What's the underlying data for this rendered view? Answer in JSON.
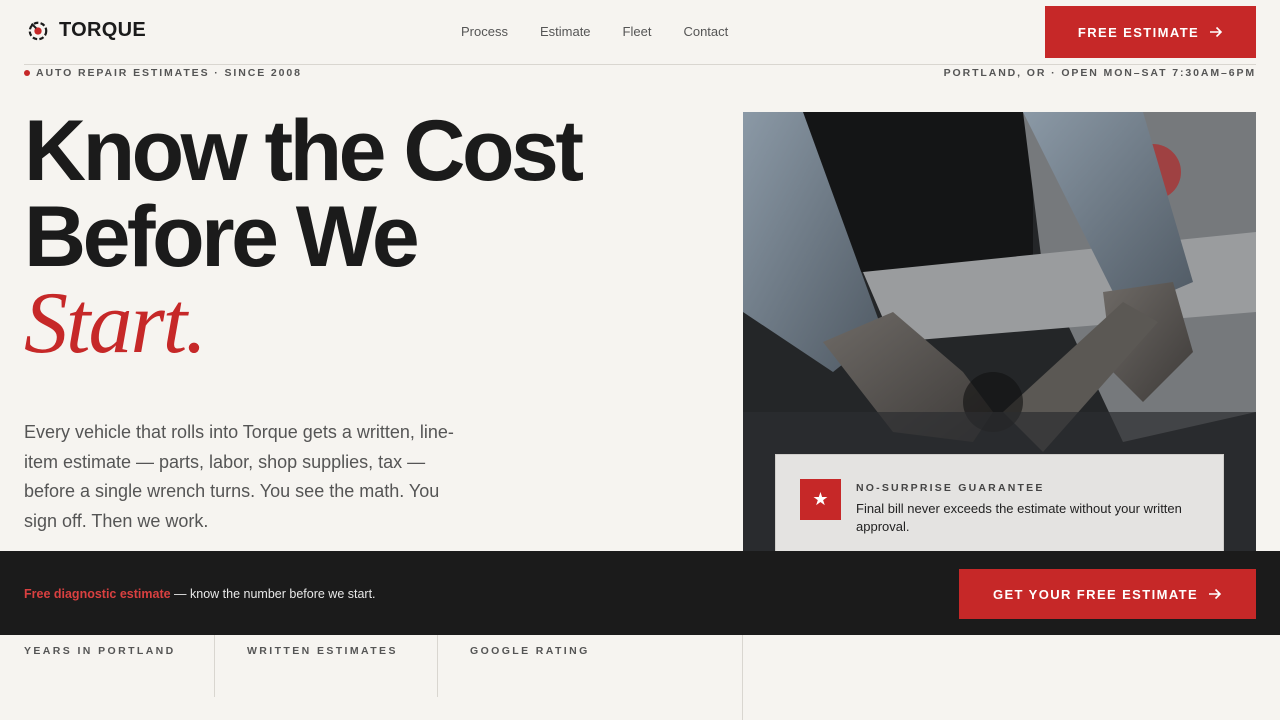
{
  "brand": {
    "name": "TORQUE",
    "icon": "gear-icon"
  },
  "nav": {
    "items": [
      "Process",
      "Estimate",
      "Fleet",
      "Contact"
    ]
  },
  "header_cta": {
    "label": "FREE ESTIMATE",
    "icon": "arrow-right-icon"
  },
  "subbar": {
    "left": "AUTO REPAIR ESTIMATES · SINCE 2008",
    "right": "PORTLAND, OR · OPEN MON–SAT 7:30AM–6PM"
  },
  "hero": {
    "line1": "Know the Cost",
    "line2": "Before We",
    "accent": "Start.",
    "intro": "Every vehicle that rolls into Torque gets a written, line-item estimate — parts, labor, shop supplies, tax — before a single wrench turns. You see the math. You sign off. Then we work."
  },
  "guarantee": {
    "icon": "star-icon",
    "title": "NO-SURPRISE GUARANTEE",
    "text": "Final bill never exceeds the estimate without your written approval."
  },
  "band": {
    "highlight": "Free diagnostic estimate",
    "text": " — know the number before we start.",
    "cta_label": "GET YOUR FREE ESTIMATE"
  },
  "stats": [
    {
      "label": "YEARS IN PORTLAND"
    },
    {
      "label": "WRITTEN ESTIMATES"
    },
    {
      "label": "GOOGLE RATING"
    }
  ],
  "colors": {
    "accent": "#c62828",
    "dark": "#1b1b1b",
    "background": "#f6f4f0"
  }
}
